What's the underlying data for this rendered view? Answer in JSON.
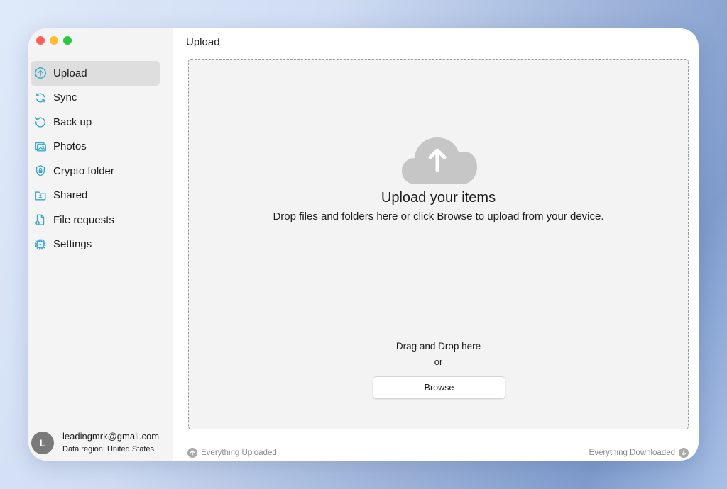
{
  "window": {
    "title": "Upload",
    "traffic_lights": [
      "close",
      "minimize",
      "zoom"
    ]
  },
  "sidebar": {
    "items": [
      {
        "label": "Upload",
        "icon": "upload-icon",
        "active": true
      },
      {
        "label": "Sync",
        "icon": "sync-icon",
        "active": false
      },
      {
        "label": "Back up",
        "icon": "backup-icon",
        "active": false
      },
      {
        "label": "Photos",
        "icon": "photos-icon",
        "active": false
      },
      {
        "label": "Crypto folder",
        "icon": "lock-shield-icon",
        "active": false
      },
      {
        "label": "Shared",
        "icon": "shared-folder-icon",
        "active": false
      },
      {
        "label": "File requests",
        "icon": "file-request-icon",
        "active": false
      },
      {
        "label": "Settings",
        "icon": "settings-icon",
        "active": false
      }
    ],
    "account": {
      "avatar_letter": "L",
      "email": "leadingmrk@gmail.com",
      "region": "Data region: United States"
    }
  },
  "dropzone": {
    "icon": "cloud-upload-icon",
    "title": "Upload your items",
    "subtitle": "Drop files and folders here or click Browse to upload from your device.",
    "drag_text": "Drag and Drop here",
    "or_text": "or",
    "browse_label": "Browse"
  },
  "status": {
    "uploaded": "Everything Uploaded",
    "downloaded": "Everything Downloaded"
  },
  "colors": {
    "accent_icon": "#3aa6c9",
    "sidebar_bg": "#f4f4f4",
    "active_item_bg": "#dedede"
  }
}
